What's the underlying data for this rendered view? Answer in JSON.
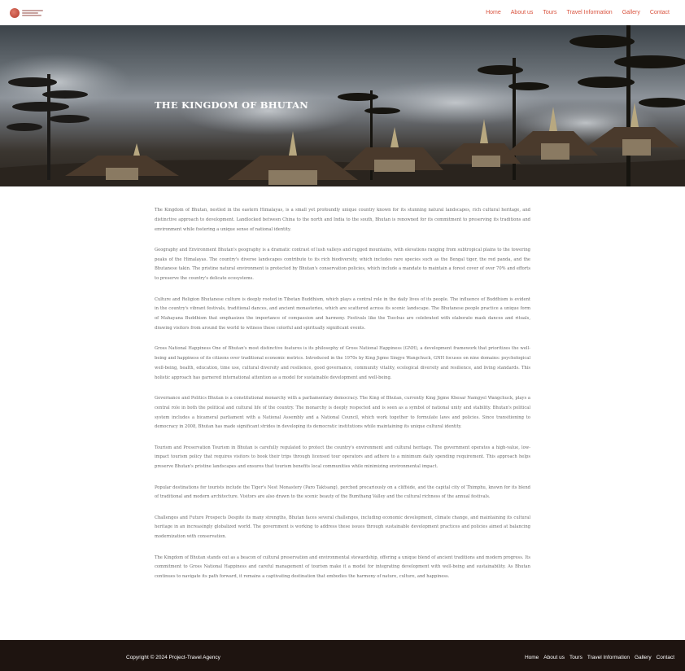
{
  "header": {
    "nav": [
      "Home",
      "About us",
      "Tours",
      "Travel Information",
      "Gallery",
      "Contact"
    ]
  },
  "hero": {
    "title": "THE KINGDOM OF BHUTAN"
  },
  "paragraphs": [
    "The Kingdom of Bhutan, nestled in the eastern Himalayas, is a small yet profoundly unique country known for its stunning natural landscapes, rich cultural heritage, and distinctive approach to development. Landlocked between China to the north and India to the south, Bhutan is renowned for its commitment to preserving its traditions and environment while fostering a unique sense of national identity.",
    "Geography and Environment Bhutan's geography is a dramatic contrast of lush valleys and rugged mountains, with elevations ranging from subtropical plains to the towering peaks of the Himalayas. The country's diverse landscapes contribute to its rich biodiversity, which includes rare species such as the Bengal tiger, the red panda, and the Bhutanese takin. The pristine natural environment is protected by Bhutan's conservation policies, which include a mandate to maintain a forest cover of over 70% and efforts to preserve the country's delicate ecosystems.",
    "Culture and Religion Bhutanese culture is deeply rooted in Tibetan Buddhism, which plays a central role in the daily lives of its people. The influence of Buddhism is evident in the country's vibrant festivals, traditional dances, and ancient monasteries, which are scattered across its scenic landscape. The Bhutanese people practice a unique form of Mahayana Buddhism that emphasizes the importance of compassion and harmony. Festivals like the Tsechus are celebrated with elaborate mask dances and rituals, drawing visitors from around the world to witness these colorful and spiritually significant events.",
    "Gross National Happiness One of Bhutan's most distinctive features is its philosophy of Gross National Happiness (GNH), a development framework that prioritizes the well-being and happiness of its citizens over traditional economic metrics. Introduced in the 1970s by King Jigme Singye Wangchuck, GNH focuses on nine domains: psychological well-being, health, education, time use, cultural diversity and resilience, good governance, community vitality, ecological diversity and resilience, and living standards. This holistic approach has garnered international attention as a model for sustainable development and well-being.",
    "Governance and Politics Bhutan is a constitutional monarchy with a parliamentary democracy. The King of Bhutan, currently King Jigme Khesar Namgyel Wangchuck, plays a central role in both the political and cultural life of the country. The monarchy is deeply respected and is seen as a symbol of national unity and stability. Bhutan's political system includes a bicameral parliament with a National Assembly and a National Council, which work together to formulate laws and policies. Since transitioning to democracy in 2008, Bhutan has made significant strides in developing its democratic institutions while maintaining its unique cultural identity.",
    "Tourism and Preservation Tourism in Bhutan is carefully regulated to protect the country's environment and cultural heritage. The government operates a high-value, low-impact tourism policy that requires visitors to book their trips through licensed tour operators and adhere to a minimum daily spending requirement. This approach helps preserve Bhutan's pristine landscapes and ensures that tourism benefits local communities while minimizing environmental impact.",
    "Popular destinations for tourists include the Tiger's Nest Monastery (Paro Taktsang), perched precariously on a cliffside, and the capital city of Thimphu, known for its blend of traditional and modern architecture. Visitors are also drawn to the scenic beauty of the Bumthang Valley and the cultural richness of the annual festivals.",
    "Challenges and Future Prospects Despite its many strengths, Bhutan faces several challenges, including economic development, climate change, and maintaining its cultural heritage in an increasingly globalized world. The government is working to address these issues through sustainable development practices and policies aimed at balancing modernization with conservation.",
    "The Kingdom of Bhutan stands out as a beacon of cultural preservation and environmental stewardship, offering a unique blend of ancient traditions and modern progress. Its commitment to Gross National Happiness and careful management of tourism make it a model for integrating development with well-being and sustainability. As Bhutan continues to navigate its path forward, it remains a captivating destination that embodies the harmony of nature, culture, and happiness."
  ],
  "footer": {
    "copyright": "Copyright © 2024 Project-Travel Agency",
    "nav": [
      "Home",
      "About us",
      "Tours",
      "Travel Information",
      "Gallery",
      "Contact"
    ]
  }
}
